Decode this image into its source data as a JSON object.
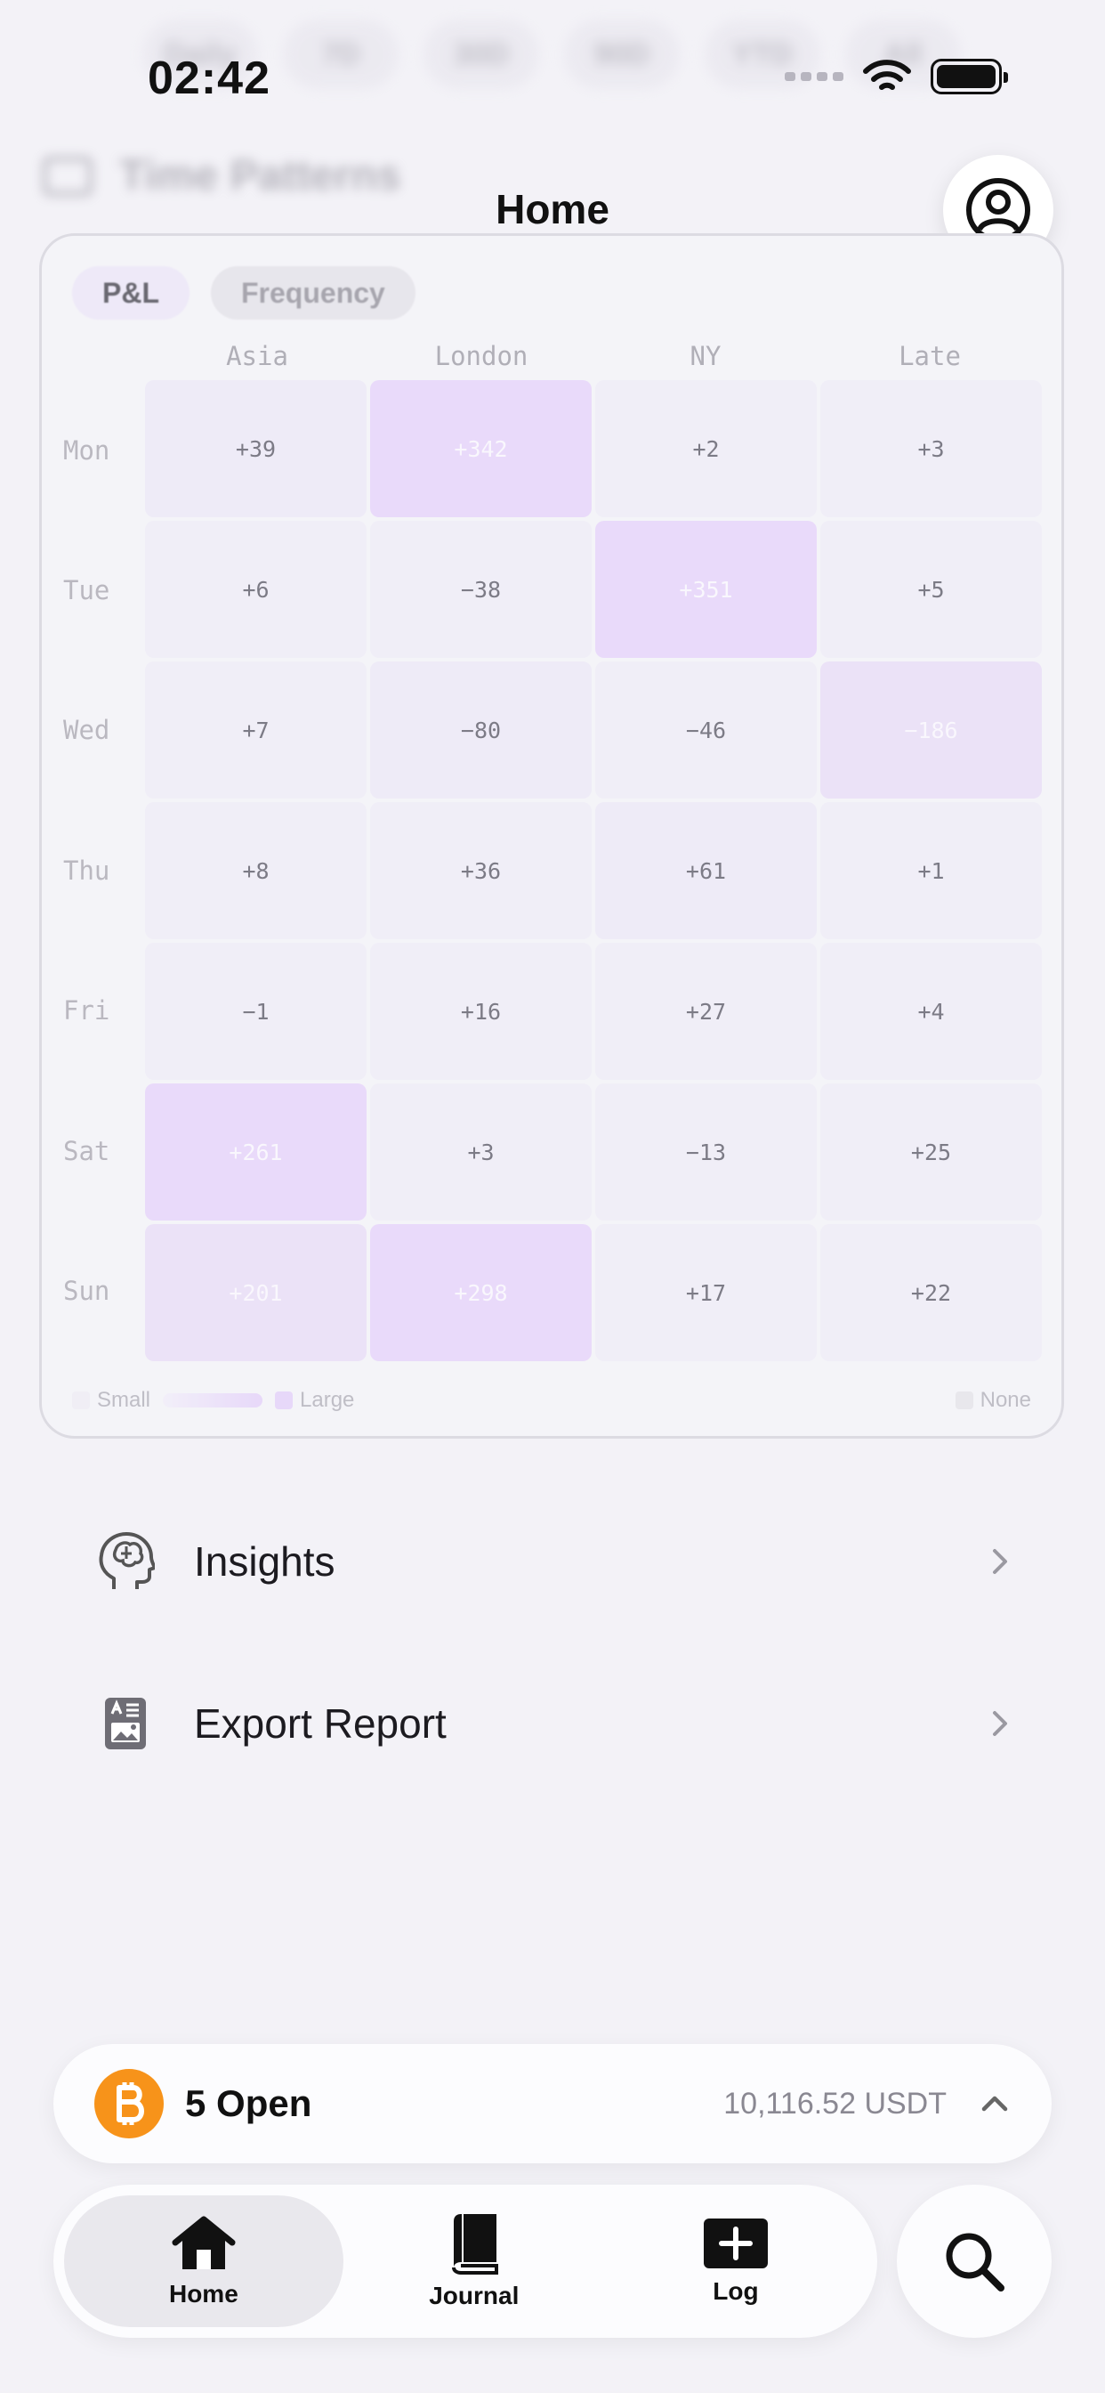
{
  "status_bar": {
    "time": "02:42"
  },
  "background_header": {
    "chips": [
      "Daily",
      "7D",
      "30D",
      "90D",
      "YTD",
      "All"
    ],
    "section_title": "Time Patterns"
  },
  "nav": {
    "title": "Home"
  },
  "heatmap": {
    "tabs": [
      {
        "label": "P&L",
        "active": true
      },
      {
        "label": "Frequency",
        "active": false
      }
    ],
    "columns": [
      "Asia",
      "London",
      "NY",
      "Late"
    ],
    "rows": [
      {
        "day": "Mon",
        "values": [
          "+39",
          "+342",
          "+2",
          "+3"
        ]
      },
      {
        "day": "Tue",
        "values": [
          "+6",
          "−38",
          "+351",
          "+5"
        ]
      },
      {
        "day": "Wed",
        "values": [
          "+7",
          "−80",
          "−46",
          "−186"
        ]
      },
      {
        "day": "Thu",
        "values": [
          "+8",
          "+36",
          "+61",
          "+1"
        ]
      },
      {
        "day": "Fri",
        "values": [
          "−1",
          "+16",
          "+27",
          "+4"
        ]
      },
      {
        "day": "Sat",
        "values": [
          "+261",
          "+3",
          "−13",
          "+25"
        ]
      },
      {
        "day": "Sun",
        "values": [
          "+201",
          "+298",
          "+17",
          "+22"
        ]
      }
    ],
    "legend": {
      "small": "Small",
      "large": "Large",
      "none": "None"
    }
  },
  "list": [
    {
      "label": "Insights",
      "icon": "brain-head-icon"
    },
    {
      "label": "Export Report",
      "icon": "report-document-icon"
    }
  ],
  "open_positions": {
    "label": "5 Open",
    "amount": "10,116.52 USDT"
  },
  "tabbar": {
    "tabs": [
      {
        "label": "Home",
        "icon": "house-icon",
        "active": true
      },
      {
        "label": "Journal",
        "icon": "book-icon",
        "active": false
      },
      {
        "label": "Log",
        "icon": "plus-square-icon",
        "active": false
      }
    ]
  },
  "colors": {
    "background": "#f3f2f7",
    "heat_strong": "#e6d2fb",
    "heat_light": "#efecf7",
    "bitcoin": "#f7931a"
  }
}
